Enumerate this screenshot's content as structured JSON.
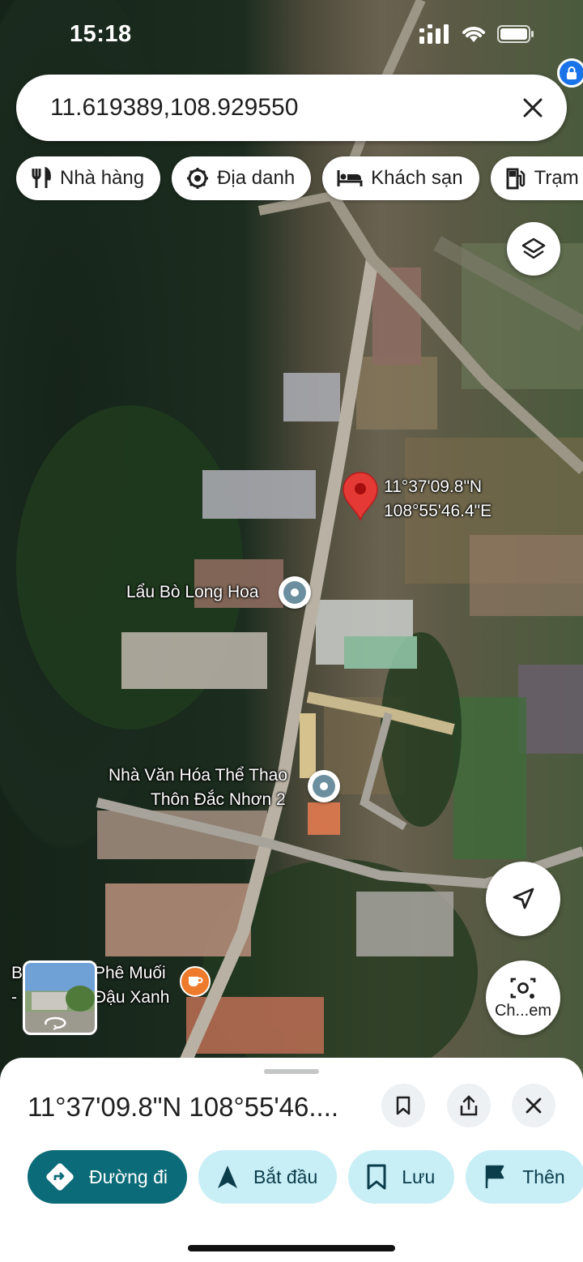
{
  "status_bar": {
    "time": "15:18",
    "icons": [
      "signal-icon",
      "wifi-icon",
      "battery-icon"
    ]
  },
  "search": {
    "value": "11.619389,108.929550",
    "clear_icon": "close-icon"
  },
  "chips": [
    {
      "label": "Nhà hàng",
      "icon": "restaurant-icon"
    },
    {
      "label": "Địa danh",
      "icon": "landmark-icon"
    },
    {
      "label": "Khách sạn",
      "icon": "hotel-icon"
    },
    {
      "label": "Trạm x",
      "icon": "gas-station-icon"
    }
  ],
  "map": {
    "pin": {
      "label_line1": "11°37'09.8\"N",
      "label_line2": "108°55'46.4\"E",
      "color": "#e53935"
    },
    "places": [
      {
        "name": "Lẩu Bò Long Hoa"
      },
      {
        "line1": "Nhà Văn Hóa Thể Thao",
        "line2": "Thôn Đắc Nhơn 2"
      },
      {
        "line1": "Phê Muối",
        "line2": "Đậu Xanh",
        "prefix1": "B",
        "prefix2": "-"
      }
    ],
    "lens_label": "Ch...em"
  },
  "sheet": {
    "title": "11°37'09.8\"N 108°55'46....",
    "actions": [
      {
        "label": "Đường đi",
        "icon": "directions-icon"
      },
      {
        "label": "Bắt đầu",
        "icon": "navigation-arrow-icon"
      },
      {
        "label": "Lưu",
        "icon": "bookmark-icon"
      },
      {
        "label": "Thên",
        "icon": "flag-icon"
      }
    ]
  },
  "colors": {
    "accent": "#0b6b78",
    "action_bg": "#c8eef6",
    "pin": "#e53935"
  }
}
